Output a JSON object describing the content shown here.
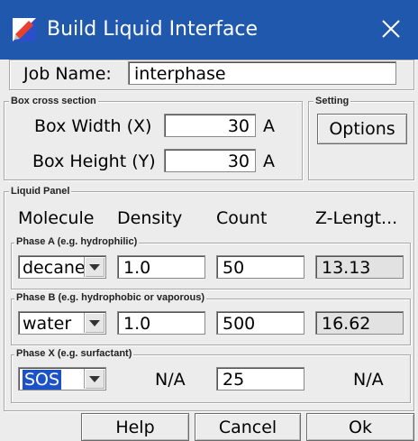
{
  "window": {
    "title": "Build Liquid Interface"
  },
  "job": {
    "label": "Job Name:",
    "value": "interphase"
  },
  "box": {
    "group_title": "Box cross section",
    "width_label": "Box Width (X)",
    "width_value": "30",
    "width_unit": "A",
    "height_label": "Box Height (Y)",
    "height_value": "30",
    "height_unit": "A"
  },
  "setting": {
    "group_title": "Setting",
    "options_label": "Options"
  },
  "liquid": {
    "group_title": "Liquid Panel",
    "headers": [
      "Molecule",
      "Density",
      "Count",
      "Z-Lengt..."
    ],
    "phase_a": {
      "title": "Phase A (e.g. hydrophilic)",
      "molecule": "decane",
      "density": "1.0",
      "count": "50",
      "zlength": "13.13"
    },
    "phase_b": {
      "title": "Phase B (e.g. hydrophobic or vaporous)",
      "molecule": "water",
      "density": "1.0",
      "count": "500",
      "zlength": "16.62"
    },
    "phase_x": {
      "title": "Phase X (e.g. surfactant)",
      "molecule": "SOS",
      "density": "N/A",
      "count": "25",
      "zlength": "N/A"
    }
  },
  "buttons": {
    "help": "Help",
    "cancel": "Cancel",
    "ok": "Ok"
  },
  "colors": {
    "titlebar": "#1f58ad",
    "selection": "#1c52c8"
  }
}
